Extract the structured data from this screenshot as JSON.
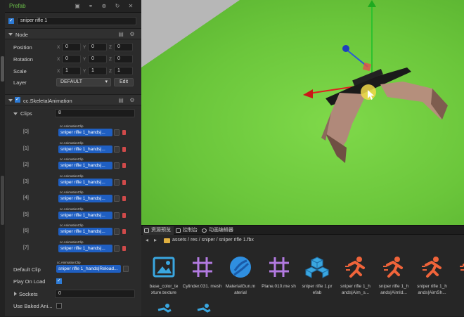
{
  "inspector": {
    "header_title": "Prefab",
    "node_name": "sniper rifle 1",
    "node_section": {
      "title": "Node",
      "position": {
        "label": "Position",
        "x": "0",
        "y": "0",
        "z": "0"
      },
      "rotation": {
        "label": "Rotation",
        "x": "0",
        "y": "0",
        "z": "0"
      },
      "scale": {
        "label": "Scale",
        "x": "1",
        "y": "1",
        "z": "1"
      },
      "layer": {
        "label": "Layer",
        "value": "DEFAULT",
        "edit": "Edit"
      }
    },
    "skeletal": {
      "title": "cc.SkeletalAnimation",
      "clips_label": "Clips",
      "clips_count": "8",
      "clips": [
        {
          "index": "[0]",
          "type": "cc.AnimationClip",
          "value": "sniper rifle 1_hands|..."
        },
        {
          "index": "[1]",
          "type": "cc.AnimationClip",
          "value": "sniper rifle 1_hands|..."
        },
        {
          "index": "[2]",
          "type": "cc.AnimationClip",
          "value": "sniper rifle 1_hands|..."
        },
        {
          "index": "[3]",
          "type": "cc.AnimationClip",
          "value": "sniper rifle 1_hands|..."
        },
        {
          "index": "[4]",
          "type": "cc.AnimationClip",
          "value": "sniper rifle 1_hands|..."
        },
        {
          "index": "[5]",
          "type": "cc.AnimationClip",
          "value": "sniper rifle 1_hands|..."
        },
        {
          "index": "[6]",
          "type": "cc.AnimationClip",
          "value": "sniper rifle 1_hands|..."
        },
        {
          "index": "[7]",
          "type": "cc.AnimationClip",
          "value": "sniper rifle 1_hands|..."
        }
      ],
      "default_clip_label": "Default Clip",
      "default_clip_type": "cc.AnimationClip",
      "default_clip_value": "sniper rifle 1_hands|Reload...",
      "play_on_load_label": "Play On Load",
      "sockets_label": "Sockets",
      "sockets_value": "0",
      "use_baked_label": "Use Baked Ani..."
    }
  },
  "assets": {
    "tabs": [
      "资源预览",
      "控制台",
      "动画编辑器"
    ],
    "path": "assets / res / sniper / sniper rifle 1.fbx",
    "items": [
      {
        "name": "base_color_te xture.texture",
        "icon": "image-icon"
      },
      {
        "name": "Cylinder.031. mesh",
        "icon": "grid-icon"
      },
      {
        "name": "MaterialGun.m aterial",
        "icon": "sphere-icon"
      },
      {
        "name": "Plane.010.me sh",
        "icon": "grid-icon"
      },
      {
        "name": "sniper rifle 1.pr efab",
        "icon": "cubes-icon"
      },
      {
        "name": "sniper rifle 1_h ands|Aim_s...",
        "icon": "run-icon"
      },
      {
        "name": "sniper rifle 1_h ands|AimId...",
        "icon": "run-icon"
      },
      {
        "name": "sniper rifle 1_h ands|AimSh...",
        "icon": "run-icon"
      },
      {
        "name": "sni",
        "icon": "run-icon"
      }
    ]
  },
  "colors": {
    "accent": "#2d7bd6",
    "title_green": "#6cc04a",
    "viewport_green": "#6bc63b",
    "asset_icon_blue": "#3aa7e0",
    "anim_icon_orange": "#f0643a"
  }
}
